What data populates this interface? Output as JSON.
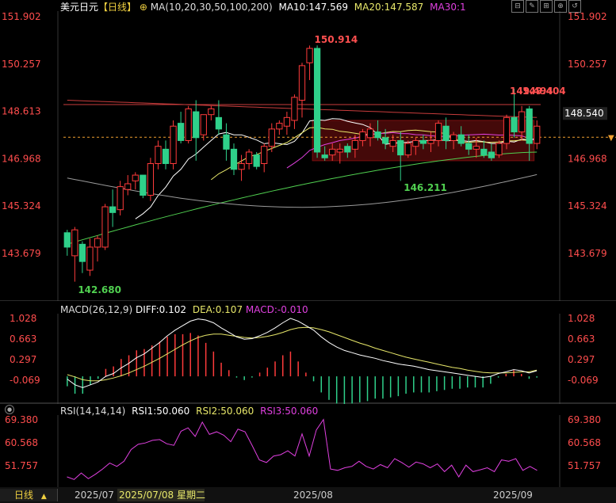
{
  "header": {
    "title": "美元日元",
    "period": "【日线】",
    "ma_label": "MA(10,20,30,50,100,200)",
    "ma10": "MA10:147.569",
    "ma20": "MA20:147.587",
    "ma30": "MA30:1"
  },
  "toolbar": {
    "buttons": [
      "⊟",
      "✎",
      "⊞",
      "⊕",
      "↺"
    ]
  },
  "colors": {
    "up": "#ff3b3b",
    "down": "#2fd08a",
    "ma10": "#ffffff",
    "ma20": "#e8e86a",
    "ma30": "#e040e0",
    "ma50": "#50d050",
    "ma100": "#9a9a9a",
    "ma200": "#c83c3c",
    "axis_text": "#ff4d4d"
  },
  "chart_data": [
    {
      "type": "candlestick",
      "name": "price",
      "y_ticks": [
        "151.902",
        "150.257",
        "148.613",
        "146.968",
        "145.324",
        "143.679"
      ],
      "current_price": "148.540",
      "annotations": [
        "150.914",
        "149.494",
        "149.404",
        "146.211",
        "142.680"
      ],
      "candles": [
        [
          144.4,
          144.5,
          143.6,
          143.9
        ],
        [
          143.6,
          144.6,
          142.7,
          144.5
        ],
        [
          144.0,
          144.1,
          143.0,
          143.4
        ],
        [
          143.1,
          144.2,
          142.9,
          143.9
        ],
        [
          143.9,
          144.3,
          143.4,
          144.2
        ],
        [
          143.9,
          145.4,
          143.8,
          145.3
        ],
        [
          145.3,
          145.9,
          144.6,
          145.1
        ],
        [
          145.2,
          146.2,
          145.0,
          146.0
        ],
        [
          145.9,
          146.4,
          145.7,
          146.1
        ],
        [
          146.2,
          146.5,
          145.9,
          146.4
        ],
        [
          146.4,
          146.4,
          145.6,
          145.7
        ],
        [
          145.7,
          147.0,
          145.5,
          146.8
        ],
        [
          146.8,
          147.6,
          146.6,
          147.4
        ],
        [
          147.3,
          147.6,
          146.6,
          146.8
        ],
        [
          146.8,
          148.3,
          146.6,
          148.1
        ],
        [
          148.2,
          148.6,
          147.5,
          147.6
        ],
        [
          147.6,
          148.8,
          147.5,
          148.7
        ],
        [
          148.6,
          149.0,
          146.9,
          147.7
        ],
        [
          147.8,
          148.5,
          147.6,
          148.5
        ],
        [
          148.5,
          148.8,
          148.3,
          148.7
        ],
        [
          148.4,
          149.0,
          147.8,
          148.0
        ],
        [
          147.8,
          148.2,
          146.9,
          147.3
        ],
        [
          147.3,
          147.5,
          146.4,
          146.6
        ],
        [
          146.6,
          147.1,
          146.2,
          146.8
        ],
        [
          146.8,
          147.3,
          146.6,
          147.2
        ],
        [
          147.1,
          147.2,
          146.6,
          146.7
        ],
        [
          146.8,
          147.5,
          146.5,
          147.4
        ],
        [
          147.4,
          148.2,
          147.2,
          148.0
        ],
        [
          148.0,
          148.3,
          147.8,
          148.2
        ],
        [
          148.1,
          148.6,
          147.8,
          148.4
        ],
        [
          148.3,
          149.2,
          148.0,
          149.1
        ],
        [
          149.0,
          150.3,
          148.4,
          150.2
        ],
        [
          150.3,
          150.9,
          149.7,
          150.8
        ],
        [
          150.8,
          150.9,
          147.0,
          147.2
        ],
        [
          147.1,
          147.4,
          146.9,
          147.0
        ],
        [
          147.1,
          147.5,
          146.9,
          147.3
        ],
        [
          147.2,
          147.5,
          146.8,
          147.3
        ],
        [
          147.4,
          147.5,
          147.0,
          147.2
        ],
        [
          147.3,
          147.8,
          147.0,
          147.6
        ],
        [
          147.6,
          148.0,
          147.4,
          147.9
        ],
        [
          147.7,
          148.2,
          147.4,
          148.0
        ],
        [
          147.9,
          148.3,
          147.6,
          147.7
        ],
        [
          147.7,
          148.0,
          147.3,
          147.5
        ],
        [
          147.4,
          147.8,
          147.2,
          147.6
        ],
        [
          147.6,
          147.9,
          146.2,
          147.1
        ],
        [
          147.1,
          147.6,
          147.0,
          147.5
        ],
        [
          147.4,
          147.7,
          147.1,
          147.6
        ],
        [
          147.6,
          147.8,
          147.3,
          147.5
        ],
        [
          147.5,
          147.9,
          147.2,
          147.6
        ],
        [
          147.6,
          148.3,
          147.4,
          148.2
        ],
        [
          148.1,
          148.4,
          147.3,
          147.6
        ],
        [
          147.6,
          147.9,
          147.3,
          147.8
        ],
        [
          147.8,
          148.1,
          147.4,
          147.5
        ],
        [
          147.5,
          147.8,
          147.1,
          147.3
        ],
        [
          147.3,
          147.7,
          147.0,
          147.4
        ],
        [
          147.3,
          147.6,
          147.0,
          147.1
        ],
        [
          147.2,
          147.5,
          146.9,
          147.0
        ],
        [
          147.1,
          147.6,
          147.0,
          147.5
        ],
        [
          147.5,
          148.5,
          147.3,
          148.4
        ],
        [
          148.4,
          149.4,
          147.7,
          147.9
        ],
        [
          147.9,
          148.8,
          147.6,
          148.6
        ],
        [
          148.7,
          148.8,
          146.9,
          147.5
        ],
        [
          147.5,
          148.3,
          147.3,
          148.1
        ]
      ]
    },
    {
      "type": "macd",
      "label": "MACD(26,12,9)",
      "diff_label": "DIFF:0.102",
      "dea_label": "DEA:0.107",
      "macd_label": "MACD:-0.010",
      "y_ticks": [
        "1.028",
        "0.663",
        "0.297",
        "-0.069"
      ],
      "diff": [
        -0.05,
        -0.15,
        -0.2,
        -0.15,
        -0.1,
        0.0,
        0.05,
        0.15,
        0.23,
        0.33,
        0.4,
        0.5,
        0.6,
        0.72,
        0.82,
        0.9,
        0.98,
        1.02,
        1.0,
        0.95,
        0.86,
        0.78,
        0.7,
        0.66,
        0.67,
        0.72,
        0.78,
        0.86,
        0.95,
        1.03,
        0.98,
        0.9,
        0.82,
        0.7,
        0.6,
        0.52,
        0.46,
        0.42,
        0.38,
        0.35,
        0.32,
        0.28,
        0.25,
        0.22,
        0.2,
        0.18,
        0.15,
        0.12,
        0.1,
        0.08,
        0.06,
        0.04,
        0.02,
        0.0,
        -0.02,
        0.0,
        0.05,
        0.08,
        0.12,
        0.1,
        0.06,
        0.1
      ],
      "dea": [
        0.03,
        -0.01,
        -0.06,
        -0.08,
        -0.08,
        -0.06,
        -0.03,
        0.01,
        0.06,
        0.12,
        0.18,
        0.25,
        0.32,
        0.4,
        0.48,
        0.56,
        0.63,
        0.69,
        0.73,
        0.75,
        0.75,
        0.73,
        0.71,
        0.69,
        0.68,
        0.69,
        0.71,
        0.74,
        0.78,
        0.83,
        0.86,
        0.87,
        0.86,
        0.83,
        0.79,
        0.74,
        0.69,
        0.64,
        0.59,
        0.55,
        0.5,
        0.46,
        0.42,
        0.38,
        0.34,
        0.31,
        0.28,
        0.25,
        0.22,
        0.19,
        0.16,
        0.14,
        0.11,
        0.09,
        0.07,
        0.06,
        0.06,
        0.06,
        0.07,
        0.08,
        0.08,
        0.11
      ]
    },
    {
      "type": "rsi",
      "label": "RSI(14,14,14)",
      "rsi1_label": "RSI1:50.060",
      "rsi2_label": "RSI2:50.060",
      "rsi3_label": "RSI3:50.060",
      "y_ticks": [
        "69.380",
        "60.568",
        "51.757"
      ],
      "values": [
        47.5,
        46.5,
        49.0,
        46.8,
        48.5,
        50.5,
        52.8,
        51.5,
        53.5,
        58.0,
        60.0,
        60.5,
        61.5,
        61.8,
        60.2,
        59.6,
        65.0,
        66.3,
        63.0,
        68.5,
        63.8,
        64.8,
        63.5,
        61.0,
        65.8,
        64.8,
        59.5,
        54.0,
        53.0,
        55.5,
        56.0,
        57.5,
        55.5,
        64.0,
        55.5,
        65.5,
        69.5,
        50.5,
        50.0,
        51.0,
        51.5,
        53.5,
        51.5,
        50.5,
        52.2,
        51.0,
        54.5,
        53.0,
        51.2,
        53.2,
        52.5,
        51.0,
        52.5,
        49.5,
        52.0,
        47.5,
        52.0,
        49.5,
        50.2,
        51.0,
        49.5,
        54.0,
        53.5,
        54.5,
        50.0,
        51.5,
        50.0
      ]
    }
  ],
  "footer": {
    "period_button": "日线",
    "dates": [
      "2025/07",
      "2025/07/08 星期二",
      "2025/08",
      "2025/09"
    ]
  }
}
